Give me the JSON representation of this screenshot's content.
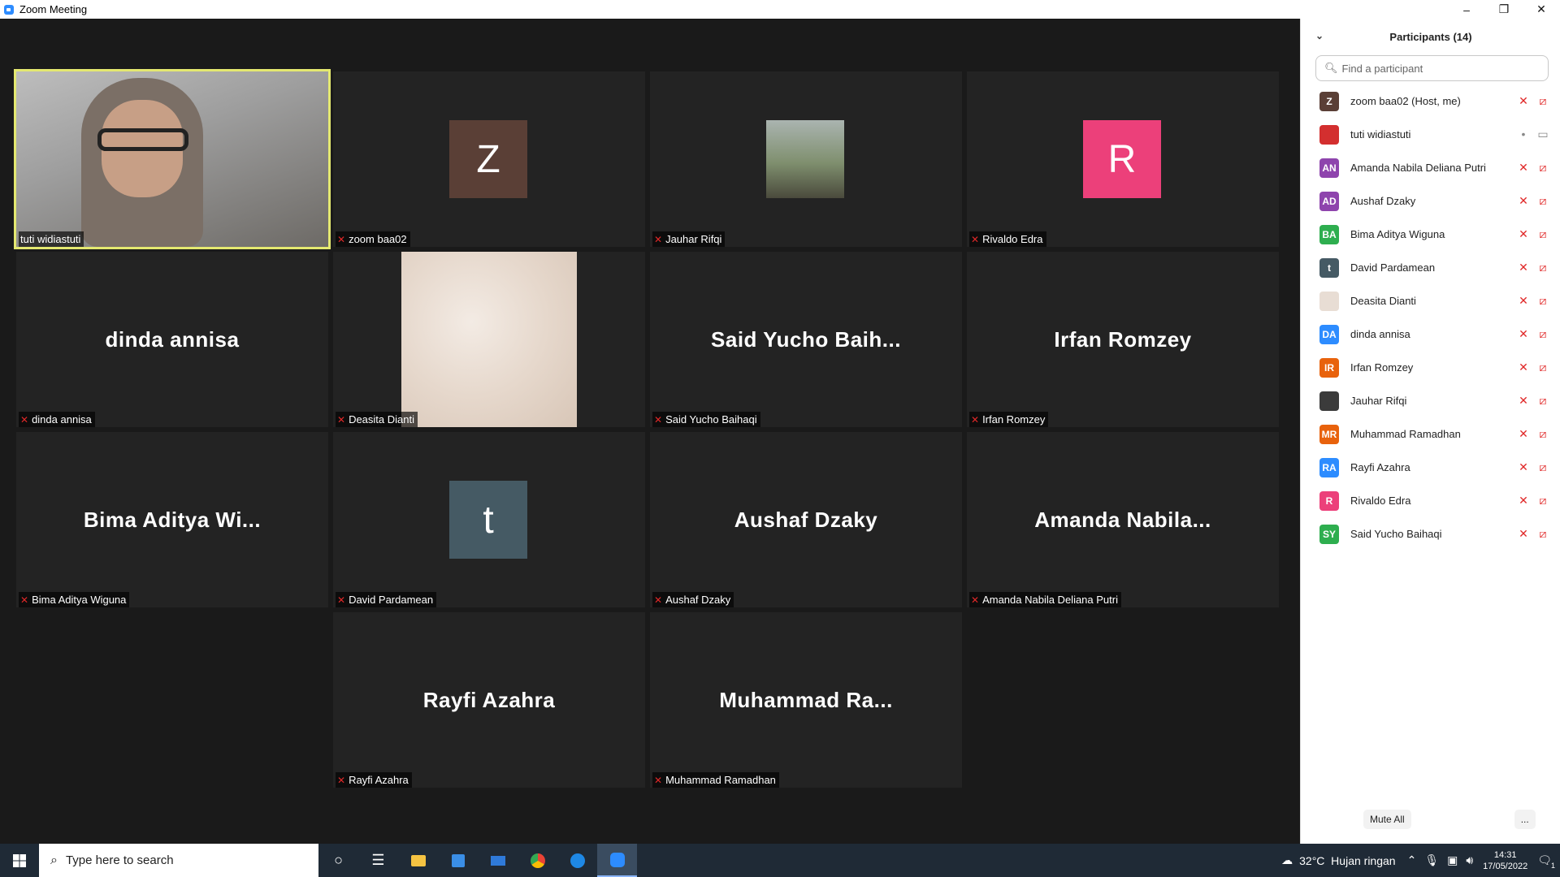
{
  "window": {
    "title": "Zoom Meeting",
    "controls": [
      "minimize-icon",
      "restore-icon",
      "close-icon"
    ]
  },
  "tiles": [
    {
      "label": "tuti widiastuti",
      "type": "video",
      "active": true,
      "mic": "on"
    },
    {
      "label": "zoom baa02",
      "type": "avatar",
      "initial": "Z",
      "color": "#5a3f36",
      "mic": "muted"
    },
    {
      "label": "Jauhar Rifqi",
      "type": "photo",
      "mic": "muted"
    },
    {
      "label": "Rivaldo Edra",
      "type": "avatar",
      "initial": "R",
      "color": "#ec407a",
      "mic": "muted"
    },
    {
      "label": "dinda annisa",
      "type": "name",
      "big": "dinda annisa",
      "mic": "muted"
    },
    {
      "label": "Deasita Dianti",
      "type": "marble",
      "mic": "muted"
    },
    {
      "label": "Said Yucho Baihaqi",
      "type": "name",
      "big": "Said Yucho Baih...",
      "mic": "muted"
    },
    {
      "label": "Irfan Romzey",
      "type": "name",
      "big": "Irfan Romzey",
      "mic": "muted"
    },
    {
      "label": "Bima Aditya Wiguna",
      "type": "name",
      "big": "Bima Aditya Wi...",
      "mic": "muted"
    },
    {
      "label": "David Pardamean",
      "type": "avatar",
      "initial": "t",
      "color": "#455a64",
      "mic": "muted"
    },
    {
      "label": "Aushaf Dzaky",
      "type": "name",
      "big": "Aushaf Dzaky",
      "mic": "muted"
    },
    {
      "label": "Amanda Nabila Deliana Putri",
      "type": "name",
      "big": "Amanda Nabila...",
      "mic": "muted"
    },
    {
      "label": "Rayfi Azahra",
      "type": "name",
      "big": "Rayfi Azahra",
      "mic": "muted"
    },
    {
      "label": "Muhammad Ramadhan",
      "type": "name",
      "big": "Muhammad Ra...",
      "mic": "muted"
    }
  ],
  "panel": {
    "title": "Participants (14)",
    "search_placeholder": "Find a participant",
    "participants": [
      {
        "name": "zoom baa02 (Host, me)",
        "initials": "Z",
        "color": "#5a3f36",
        "mic": "muted",
        "video": "off"
      },
      {
        "name": "tuti widiastuti",
        "initials": "",
        "color": "#d32f2f",
        "mic": "on",
        "video": "on"
      },
      {
        "name": "Amanda Nabila Deliana Putri",
        "initials": "AN",
        "color": "#8e44ad",
        "mic": "muted",
        "video": "off"
      },
      {
        "name": "Aushaf Dzaky",
        "initials": "AD",
        "color": "#8e44ad",
        "mic": "muted",
        "video": "off"
      },
      {
        "name": "Bima Aditya Wiguna",
        "initials": "BA",
        "color": "#2eae4f",
        "mic": "muted",
        "video": "off"
      },
      {
        "name": "David Pardamean",
        "initials": "t",
        "color": "#455a64",
        "mic": "muted",
        "video": "off"
      },
      {
        "name": "Deasita Dianti",
        "initials": "",
        "color": "#e8ddd4",
        "mic": "muted",
        "video": "off"
      },
      {
        "name": "dinda annisa",
        "initials": "DA",
        "color": "#2d8cff",
        "mic": "muted",
        "video": "off"
      },
      {
        "name": "Irfan Romzey",
        "initials": "IR",
        "color": "#e8620c",
        "mic": "muted",
        "video": "off"
      },
      {
        "name": "Jauhar Rifqi",
        "initials": "",
        "color": "#3b3b3b",
        "mic": "muted",
        "video": "off"
      },
      {
        "name": "Muhammad Ramadhan",
        "initials": "MR",
        "color": "#e8620c",
        "mic": "muted",
        "video": "off"
      },
      {
        "name": "Rayfi Azahra",
        "initials": "RA",
        "color": "#2d8cff",
        "mic": "muted",
        "video": "off"
      },
      {
        "name": "Rivaldo Edra",
        "initials": "R",
        "color": "#ec407a",
        "mic": "muted",
        "video": "off"
      },
      {
        "name": "Said Yucho Baihaqi",
        "initials": "SY",
        "color": "#2eae4f",
        "mic": "muted",
        "video": "off"
      }
    ],
    "mute_all": "Mute All",
    "more": "..."
  },
  "taskbar": {
    "search_placeholder": "Type here to search",
    "weather": "32°C  Hujan ringan",
    "time": "14:31",
    "date": "17/05/2022",
    "notifications": "1"
  }
}
